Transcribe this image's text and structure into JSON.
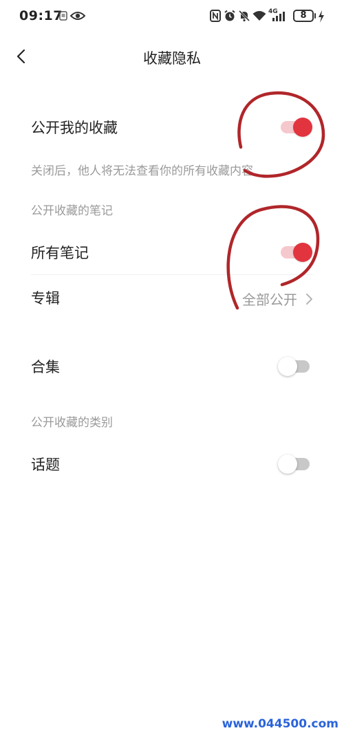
{
  "status_bar": {
    "time": "09:17",
    "network": "4G",
    "battery": "8"
  },
  "header": {
    "title": "收藏隐私"
  },
  "settings": {
    "public_collections": {
      "label": "公开我的收藏",
      "enabled": true,
      "description": "关闭后，他人将无法查看你的所有收藏内容"
    },
    "notes_section": {
      "label": "公开收藏的笔记",
      "all_notes": {
        "label": "所有笔记",
        "enabled": true
      },
      "albums": {
        "label": "专辑",
        "value": "全部公开"
      },
      "collections": {
        "label": "合集",
        "enabled": false
      }
    },
    "categories_section": {
      "label": "公开收藏的类别",
      "topics": {
        "label": "话题",
        "enabled": false
      }
    }
  },
  "colors": {
    "toggle_on": "#e1343f",
    "toggle_on_track": "#f5c8cd",
    "toggle_off_track": "#c8c8c8",
    "annotation": "#b0262a",
    "watermark": "#2b63d9"
  },
  "watermark": "www.044500.com"
}
